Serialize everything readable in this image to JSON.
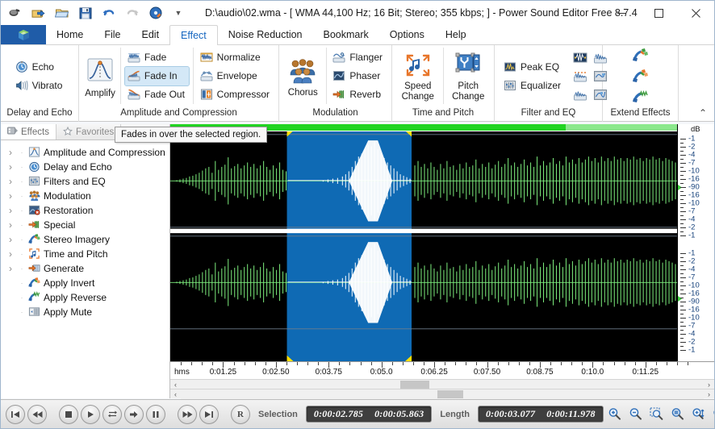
{
  "window": {
    "title": "D:\\audio\\02.wma - [ WMA 44,100 Hz; 16 Bit; Stereo; 355 kbps; ] - Power Sound Editor Free 8.7.4",
    "minimize": "—",
    "maximize": "□",
    "close": "✕"
  },
  "quick_access": [
    {
      "name": "headset-icon"
    },
    {
      "name": "import-icon"
    },
    {
      "name": "open-icon"
    },
    {
      "name": "save-icon"
    },
    {
      "name": "undo-icon"
    },
    {
      "name": "redo-icon"
    },
    {
      "name": "burn-cd-icon"
    }
  ],
  "ribbon_tabs": [
    {
      "label": "Home",
      "active": false
    },
    {
      "label": "File",
      "active": false
    },
    {
      "label": "Edit",
      "active": false
    },
    {
      "label": "Effect",
      "active": true
    },
    {
      "label": "Noise Reduction",
      "active": false
    },
    {
      "label": "Bookmark",
      "active": false
    },
    {
      "label": "Options",
      "active": false
    },
    {
      "label": "Help",
      "active": false
    }
  ],
  "ribbon": {
    "collapse_glyph": "⌃",
    "groups": [
      {
        "title": "Delay and Echo",
        "small": [
          {
            "label": "Echo",
            "icon": "echo-icon",
            "selected": false
          },
          {
            "label": "Vibrato",
            "icon": "vibrato-icon",
            "selected": false
          }
        ]
      },
      {
        "title": "Amplitude and Compression",
        "big": {
          "label": "Amplify",
          "icon": "amplify-icon"
        },
        "col1": [
          {
            "label": "Fade",
            "icon": "fade-icon",
            "selected": false
          },
          {
            "label": "Fade In",
            "icon": "fade-in-icon",
            "selected": true
          },
          {
            "label": "Fade Out",
            "icon": "fade-out-icon",
            "selected": false
          }
        ],
        "col2": [
          {
            "label": "Normalize",
            "icon": "normalize-icon",
            "selected": false
          },
          {
            "label": "Envelope",
            "icon": "envelope-icon",
            "selected": false
          },
          {
            "label": "Compressor",
            "icon": "compressor-icon",
            "selected": false
          }
        ]
      },
      {
        "title": "Modulation",
        "big": {
          "label": "Chorus",
          "icon": "chorus-icon"
        },
        "col1": [
          {
            "label": "Flanger",
            "icon": "flanger-icon",
            "selected": false
          },
          {
            "label": "Phaser",
            "icon": "phaser-icon",
            "selected": false
          },
          {
            "label": "Reverb",
            "icon": "reverb-icon",
            "selected": false
          }
        ]
      },
      {
        "title": "Time and Pitch",
        "bigs": [
          {
            "label_line1": "Speed",
            "label_line2": "Change",
            "icon": "speed-change-icon"
          },
          {
            "label_line1": "Pitch",
            "label_line2": "Change",
            "icon": "pitch-change-icon"
          }
        ]
      },
      {
        "title": "Filter and EQ",
        "small": [
          {
            "label": "Peak EQ",
            "icon": "peak-eq-icon",
            "selected": false
          },
          {
            "label": "Equalizer",
            "icon": "equalizer-icon",
            "selected": false
          }
        ],
        "grid": [
          [
            "scientific-filter-icon",
            "fft-filter-icon"
          ],
          [
            "notch-filter-icon",
            "graphic-phase-icon"
          ],
          [
            "dynamic-eq-icon",
            "parametric-eq-icon"
          ]
        ]
      },
      {
        "title": "Extend Effects",
        "grid": [
          [
            "stereo-tools-icon"
          ],
          [
            "vocal-remover-icon"
          ],
          [
            "custom-effect-icon"
          ]
        ]
      }
    ]
  },
  "tooltip": {
    "text": "Fades in over the selected region."
  },
  "dock": {
    "tabs": [
      {
        "label": "Effects",
        "icon": "effects-icon",
        "active": true
      },
      {
        "label": "Favorites",
        "icon": "star-icon",
        "active": false
      }
    ],
    "tree": [
      {
        "label": "Amplitude and Compression",
        "icon": "amplitude-icon",
        "expandable": true
      },
      {
        "label": "Delay and Echo",
        "icon": "delay-icon",
        "expandable": true
      },
      {
        "label": "Filters and EQ",
        "icon": "filters-icon",
        "expandable": true
      },
      {
        "label": "Modulation",
        "icon": "modulation-icon",
        "expandable": true
      },
      {
        "label": "Restoration",
        "icon": "restoration-icon",
        "expandable": true
      },
      {
        "label": "Special",
        "icon": "special-icon",
        "expandable": true
      },
      {
        "label": "Stereo Imagery",
        "icon": "stereo-imagery-icon",
        "expandable": true
      },
      {
        "label": "Time and Pitch",
        "icon": "time-pitch-icon",
        "expandable": true
      },
      {
        "label": "Generate",
        "icon": "generate-icon",
        "expandable": true
      },
      {
        "label": "Apply Invert",
        "icon": "apply-invert-icon",
        "expandable": false
      },
      {
        "label": "Apply Reverse",
        "icon": "apply-reverse-icon",
        "expandable": false
      },
      {
        "label": "Apply Mute",
        "icon": "apply-mute-icon",
        "expandable": false
      }
    ]
  },
  "editor": {
    "db_axis_title": "dB",
    "db_labels": [
      "-1",
      "-2",
      "-4",
      "-7",
      "-10",
      "-16",
      "-90",
      "-16",
      "-10",
      "-7",
      "-4",
      "-2",
      "-1"
    ],
    "time_axis_unit": "hms",
    "time_labels": [
      "0:01.25",
      "0:02.50",
      "0:03.75",
      "0:05.0",
      "0:06.25",
      "0:07.50",
      "0:08.75",
      "0:10.0",
      "0:11.25"
    ],
    "channels": 2,
    "waveform_color": "#7dee7d",
    "selection_color": "#0f6ab4",
    "selection_waveform_color": "#ffffff",
    "background_color": "#000000",
    "scroll_left_glyph": "‹",
    "scroll_right_glyph": "›"
  },
  "transport": [
    {
      "name": "go-to-start-button",
      "glyph": "skip-back-icon"
    },
    {
      "name": "rewind-button",
      "glyph": "rewind-icon"
    },
    {
      "name": "stop-button",
      "glyph": "stop-icon"
    },
    {
      "name": "play-button",
      "glyph": "play-icon"
    },
    {
      "name": "loop-button",
      "glyph": "loop-icon"
    },
    {
      "name": "record-forward-button",
      "glyph": "arrow-right-icon"
    },
    {
      "name": "pause-button",
      "glyph": "pause-icon"
    },
    {
      "name": "fast-forward-button",
      "glyph": "fast-forward-icon"
    },
    {
      "name": "go-to-end-button",
      "glyph": "skip-forward-icon"
    },
    {
      "name": "record-button",
      "glyph": "R"
    }
  ],
  "status": {
    "selection_label": "Selection",
    "selection_start": "0:00:02.785",
    "selection_end": "0:00:05.863",
    "length_label": "Length",
    "length_value": "0:00:03.077",
    "total_value": "0:00:11.978"
  },
  "zoom_buttons": [
    {
      "name": "zoom-in-button",
      "icon": "zoom-in-icon"
    },
    {
      "name": "zoom-out-button",
      "icon": "zoom-out-icon"
    },
    {
      "name": "zoom-to-selection-button",
      "icon": "zoom-selection-icon"
    },
    {
      "name": "zoom-full-button",
      "icon": "zoom-full-icon"
    },
    {
      "name": "zoom-in-vertical-button",
      "icon": "zoom-in-vertical-icon"
    },
    {
      "name": "zoom-out-vertical-button",
      "icon": "zoom-out-vertical-icon"
    }
  ],
  "colors": {
    "accent": "#1566c0",
    "logo_bg": "#1f5ca8",
    "selection": "#0f6ab4",
    "waveform": "#7dee7d",
    "overview_strip": "#8ce88c",
    "overview_selected": "#22d422"
  }
}
